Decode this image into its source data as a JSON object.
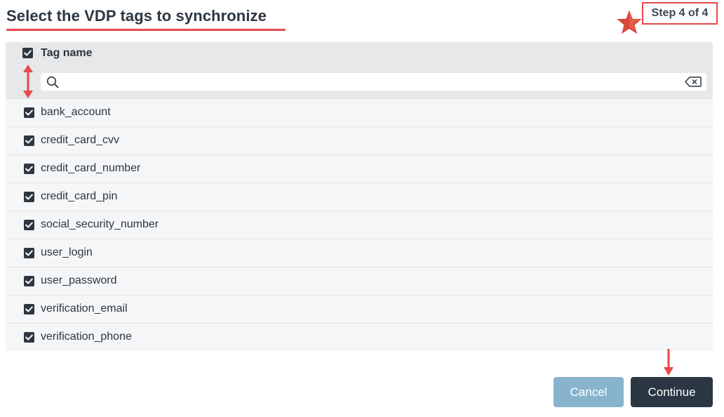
{
  "page": {
    "title": "Select the VDP tags to synchronize",
    "step_badge": "Step 4 of 4"
  },
  "table": {
    "header_label": "Tag name",
    "header_checked": true,
    "search": {
      "value": "",
      "placeholder": ""
    },
    "rows": [
      {
        "label": "bank_account",
        "checked": true
      },
      {
        "label": "credit_card_cvv",
        "checked": true
      },
      {
        "label": "credit_card_number",
        "checked": true
      },
      {
        "label": "credit_card_pin",
        "checked": true
      },
      {
        "label": "social_security_number",
        "checked": true
      },
      {
        "label": "user_login",
        "checked": true
      },
      {
        "label": "user_password",
        "checked": true
      },
      {
        "label": "verification_email",
        "checked": true
      },
      {
        "label": "verification_phone",
        "checked": true
      }
    ]
  },
  "footer": {
    "cancel_label": "Cancel",
    "continue_label": "Continue"
  },
  "colors": {
    "accent_red": "#e8494b",
    "primary_dark": "#2b3742",
    "cancel_blue": "#87b4cc",
    "panel_header": "#e6e8ea"
  },
  "icons": {
    "annotation_star": "star-icon",
    "search": "search-icon",
    "clear": "backspace-clear-icon",
    "checkbox": "checkbox-checked-icon"
  }
}
